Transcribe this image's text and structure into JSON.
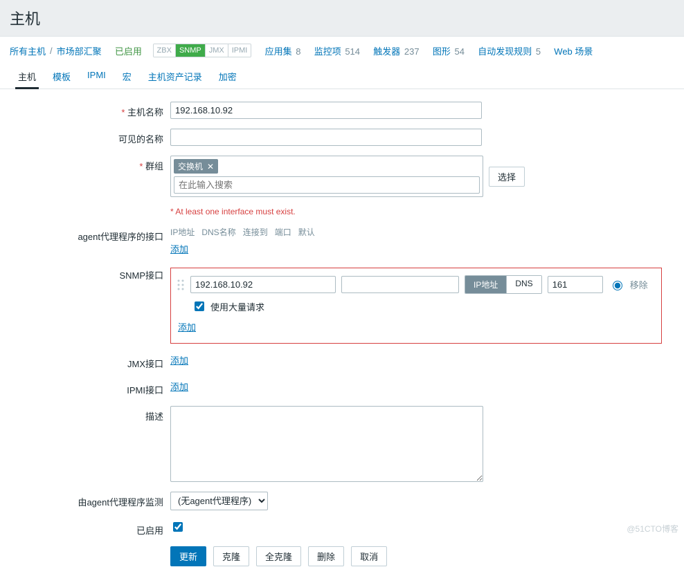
{
  "header": {
    "title": "主机"
  },
  "breadcrumb": {
    "all_hosts": "所有主机",
    "current": "市场部汇聚",
    "enabled": "已启用",
    "pills": [
      "ZBX",
      "SNMP",
      "JMX",
      "IPMI"
    ],
    "active_pill": "SNMP",
    "stats": [
      {
        "label": "应用集",
        "count": "8"
      },
      {
        "label": "监控项",
        "count": "514"
      },
      {
        "label": "触发器",
        "count": "237"
      },
      {
        "label": "图形",
        "count": "54"
      },
      {
        "label": "自动发现规则",
        "count": "5"
      },
      {
        "label": "Web 场景",
        "count": ""
      }
    ]
  },
  "tabs": [
    "主机",
    "模板",
    "IPMI",
    "宏",
    "主机资产记录",
    "加密"
  ],
  "active_tab": "主机",
  "form": {
    "host_name": {
      "label": "主机名称",
      "value": "192.168.10.92"
    },
    "visible_name": {
      "label": "可见的名称",
      "value": ""
    },
    "groups": {
      "label": "群组",
      "tag": "交换机",
      "placeholder": "在此输入搜索",
      "select_btn": "选择"
    },
    "iface_warning": "At least one interface must exist.",
    "agent_label": "agent代理程序的接口",
    "iface_headers": [
      "IP地址",
      "DNS名称",
      "连接到",
      "端口",
      "默认"
    ],
    "add_link": "添加",
    "snmp": {
      "label": "SNMP接口",
      "ip": "192.168.10.92",
      "dns": "",
      "connect_ip": "IP地址",
      "connect_dns": "DNS",
      "port": "161",
      "remove": "移除",
      "bulk_label": "使用大量请求"
    },
    "jmx_label": "JMX接口",
    "ipmi_label": "IPMI接口",
    "description_label": "描述",
    "description_value": "",
    "monitored_by": {
      "label": "由agent代理程序监测",
      "value": "(无agent代理程序)"
    },
    "enabled_label": "已启用"
  },
  "buttons": {
    "update": "更新",
    "clone": "克隆",
    "full_clone": "全克隆",
    "delete": "删除",
    "cancel": "取消"
  },
  "watermark": "@51CTO博客"
}
